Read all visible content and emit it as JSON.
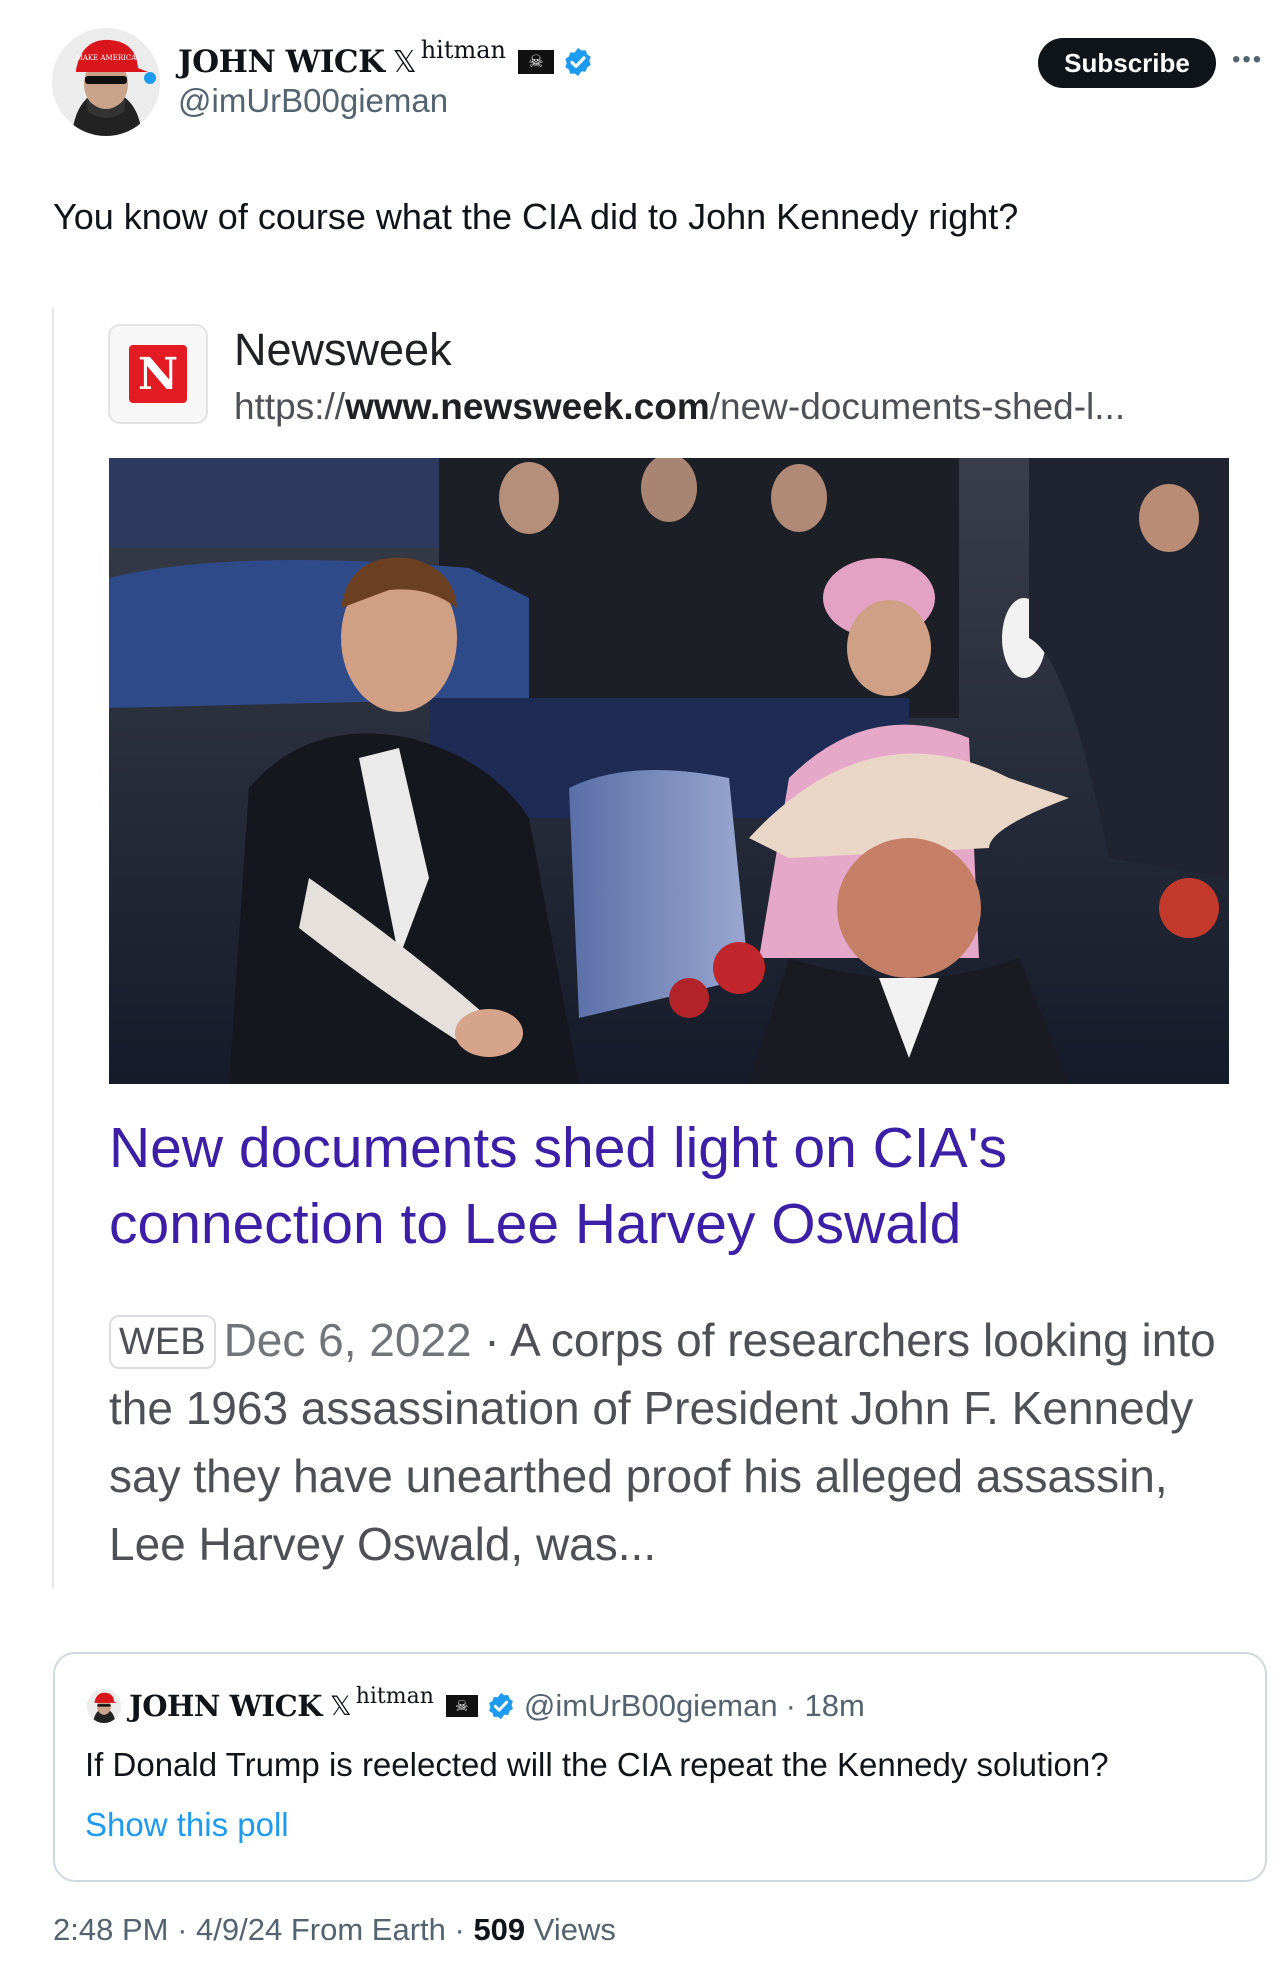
{
  "author": {
    "name": "JOHN WICK",
    "name_suffix_x": "𝕏",
    "name_suffix_sup": "hitman",
    "handle": "@imUrB00gieman",
    "avatar": "avatar-man-red-cap",
    "hat_text": "MAKE AMERICA GREAT AGAIN"
  },
  "header": {
    "subscribe_label": "Subscribe",
    "more_icon": "more-icon"
  },
  "tweet": {
    "text": "You know of course what the CIA did to John Kennedy right?"
  },
  "link_card": {
    "source_logo": "N",
    "source_name": "Newsweek",
    "url_prefix": "https://",
    "url_domain": "www.newsweek.com",
    "url_path": "/new-documents-shed-l...",
    "image": "photo-kennedy-motorcade",
    "headline": "New documents shed light on CIA's connection to Lee Harvey Oswald",
    "badge": "WEB",
    "date": "Dec 6, 2022",
    "separator": " · ",
    "snippet": "A corps of researchers looking into the 1963 assassination of President John F. Kennedy say they have unearthed proof his alleged assassin, Lee Harvey Oswald, was..."
  },
  "quoted_tweet": {
    "name": "JOHN WICK",
    "name_suffix_x": "𝕏",
    "name_suffix_sup": "hitman",
    "handle": "@imUrB00gieman",
    "time": "· 18m",
    "text": "If Donald Trump is reelected will the CIA repeat the Kennedy solution?",
    "poll_link": "Show this poll"
  },
  "meta": {
    "time": "2:48 PM",
    "date": "4/9/24",
    "location": "From Earth",
    "views_count": "509",
    "views_label": "Views"
  },
  "colors": {
    "verified": "#1d9bf0",
    "headline": "#3d1ea6",
    "link": "#1d9bf0",
    "newsweek_red": "#e31b23"
  }
}
